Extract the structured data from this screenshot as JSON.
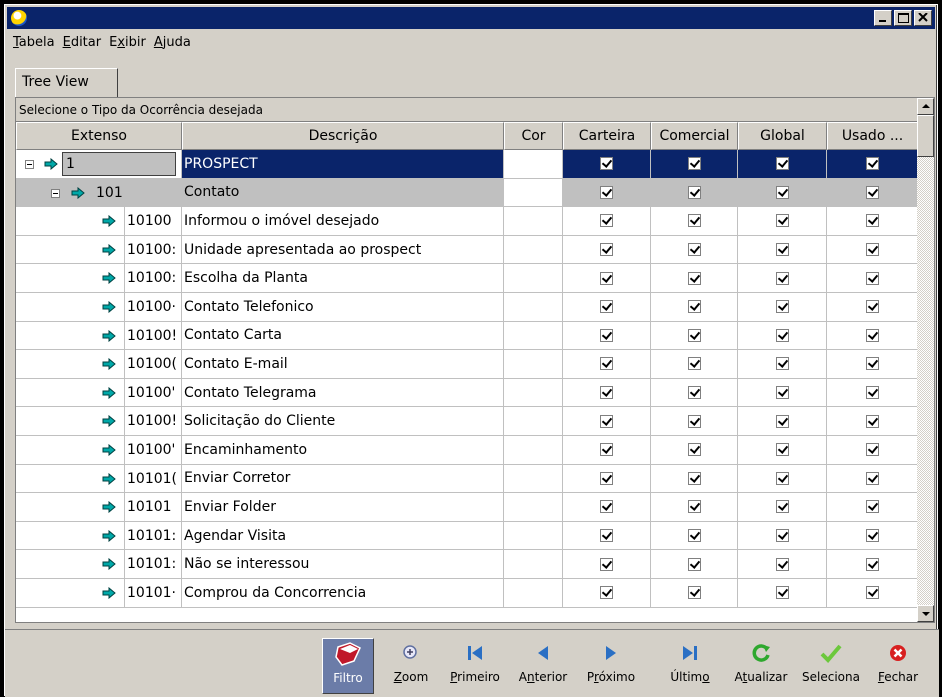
{
  "window": {
    "title": ""
  },
  "menu": [
    {
      "u": "T",
      "rest": "abela"
    },
    {
      "u": "E",
      "rest": "ditar"
    },
    {
      "u": "",
      "pre": "E",
      "u2": "x",
      "rest": "ibir"
    },
    {
      "u": "A",
      "rest": "juda"
    }
  ],
  "menu_labels": [
    "Tabela",
    "Editar",
    "Exibir",
    "Ajuda"
  ],
  "tab_label": "Tree View",
  "caption": "Selecione o Tipo da Ocorrência desejada",
  "columns": [
    "Extenso",
    "Descrição",
    "Cor",
    "Carteira",
    "Comercial",
    "Global",
    "Usado ..."
  ],
  "rows": [
    {
      "code": "1",
      "desc": "PROSPECT",
      "level": 0
    },
    {
      "code": "101",
      "desc": "Contato",
      "level": 1
    },
    {
      "code": "10100",
      "desc": "Informou o imóvel desejado",
      "level": 2
    },
    {
      "code": "10100:",
      "desc": "Unidade apresentada ao prospect",
      "level": 2
    },
    {
      "code": "10100:",
      "desc": "Escolha da Planta",
      "level": 2
    },
    {
      "code": "10100·",
      "desc": "Contato Telefonico",
      "level": 2
    },
    {
      "code": "10100!",
      "desc": "Contato Carta",
      "level": 2
    },
    {
      "code": "10100(",
      "desc": "Contato E-mail",
      "level": 2
    },
    {
      "code": "10100'",
      "desc": "Contato Telegrama",
      "level": 2
    },
    {
      "code": "10100!",
      "desc": "Solicitação do Cliente",
      "level": 2
    },
    {
      "code": "10100'",
      "desc": "Encaminhamento",
      "level": 2
    },
    {
      "code": "10101(",
      "desc": "Enviar Corretor",
      "level": 2
    },
    {
      "code": "10101",
      "desc": "Enviar Folder",
      "level": 2
    },
    {
      "code": "10101:",
      "desc": "Agendar Visita",
      "level": 2
    },
    {
      "code": "10101:",
      "desc": "Não se interessou",
      "level": 2
    },
    {
      "code": "10101·",
      "desc": "Comprou da Concorrencia",
      "level": 2
    }
  ],
  "toolbar": {
    "filtro": "Filtro",
    "zoom": "Zoom",
    "primeiro": "Primeiro",
    "anterior": "Anterior",
    "proximo": "Próximo",
    "ultimo": "Último",
    "atualizar": "Atualizar",
    "seleciona": "Seleciona",
    "fechar": "Fechar"
  },
  "colors": {
    "titlebar": "#0a246a",
    "selected": "#0a246a",
    "arrow": "#00a0a0",
    "face": "#d4d0c8"
  }
}
